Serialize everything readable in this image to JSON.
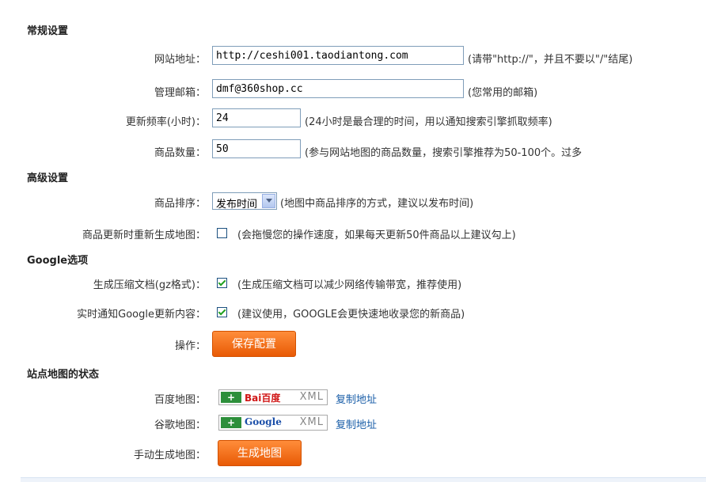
{
  "sections": {
    "general": "常规设置",
    "advanced": "高级设置",
    "google": "Google选项",
    "status": "站点地图的状态"
  },
  "fields": {
    "site_url": {
      "label": "网站地址：",
      "value": "http://ceshi001.taodiantong.com",
      "hint": "(请带\"http://\"，并且不要以\"/\"结尾)"
    },
    "email": {
      "label": "管理邮箱：",
      "value": "dmf@360shop.cc",
      "hint": "(您常用的邮箱)"
    },
    "frequency": {
      "label": "更新频率(小时)：",
      "value": "24",
      "hint": "(24小时是最合理的时间，用以通知搜索引擎抓取频率)"
    },
    "product_count": {
      "label": "商品数量：",
      "value": "50",
      "hint": "(参与网站地图的商品数量，搜索引擎推荐为50-100个。过多"
    }
  },
  "advanced": {
    "sort": {
      "label": "商品排序：",
      "selected": "发布时间",
      "hint": "(地图中商品排序的方式，建议以发布时间)"
    },
    "regen": {
      "label": "商品更新时重新生成地图：",
      "checked": false,
      "hint": "(会拖慢您的操作速度，如果每天更新50件商品以上建议勾上)"
    }
  },
  "google": {
    "gz": {
      "label": "生成压缩文档(gz格式)：",
      "checked": true,
      "hint": "(生成压缩文档可以减少网络传输带宽，推荐使用)"
    },
    "notify": {
      "label": "实时通知Google更新内容：",
      "checked": true,
      "hint": "(建议使用，GOOGLE会更快速地收录您的新商品)"
    }
  },
  "actions": {
    "label": "操作：",
    "save": "保存配置"
  },
  "status": {
    "baidu": {
      "label": "百度地图：",
      "plus": "+",
      "brand": "Bai百度",
      "xml": "XML",
      "copy": "复制地址"
    },
    "google": {
      "label": "谷歌地图：",
      "plus": "+",
      "brand": "Google",
      "xml": "XML",
      "copy": "复制地址"
    },
    "manual": {
      "label": "手动生成地图：",
      "button": "生成地图"
    }
  }
}
